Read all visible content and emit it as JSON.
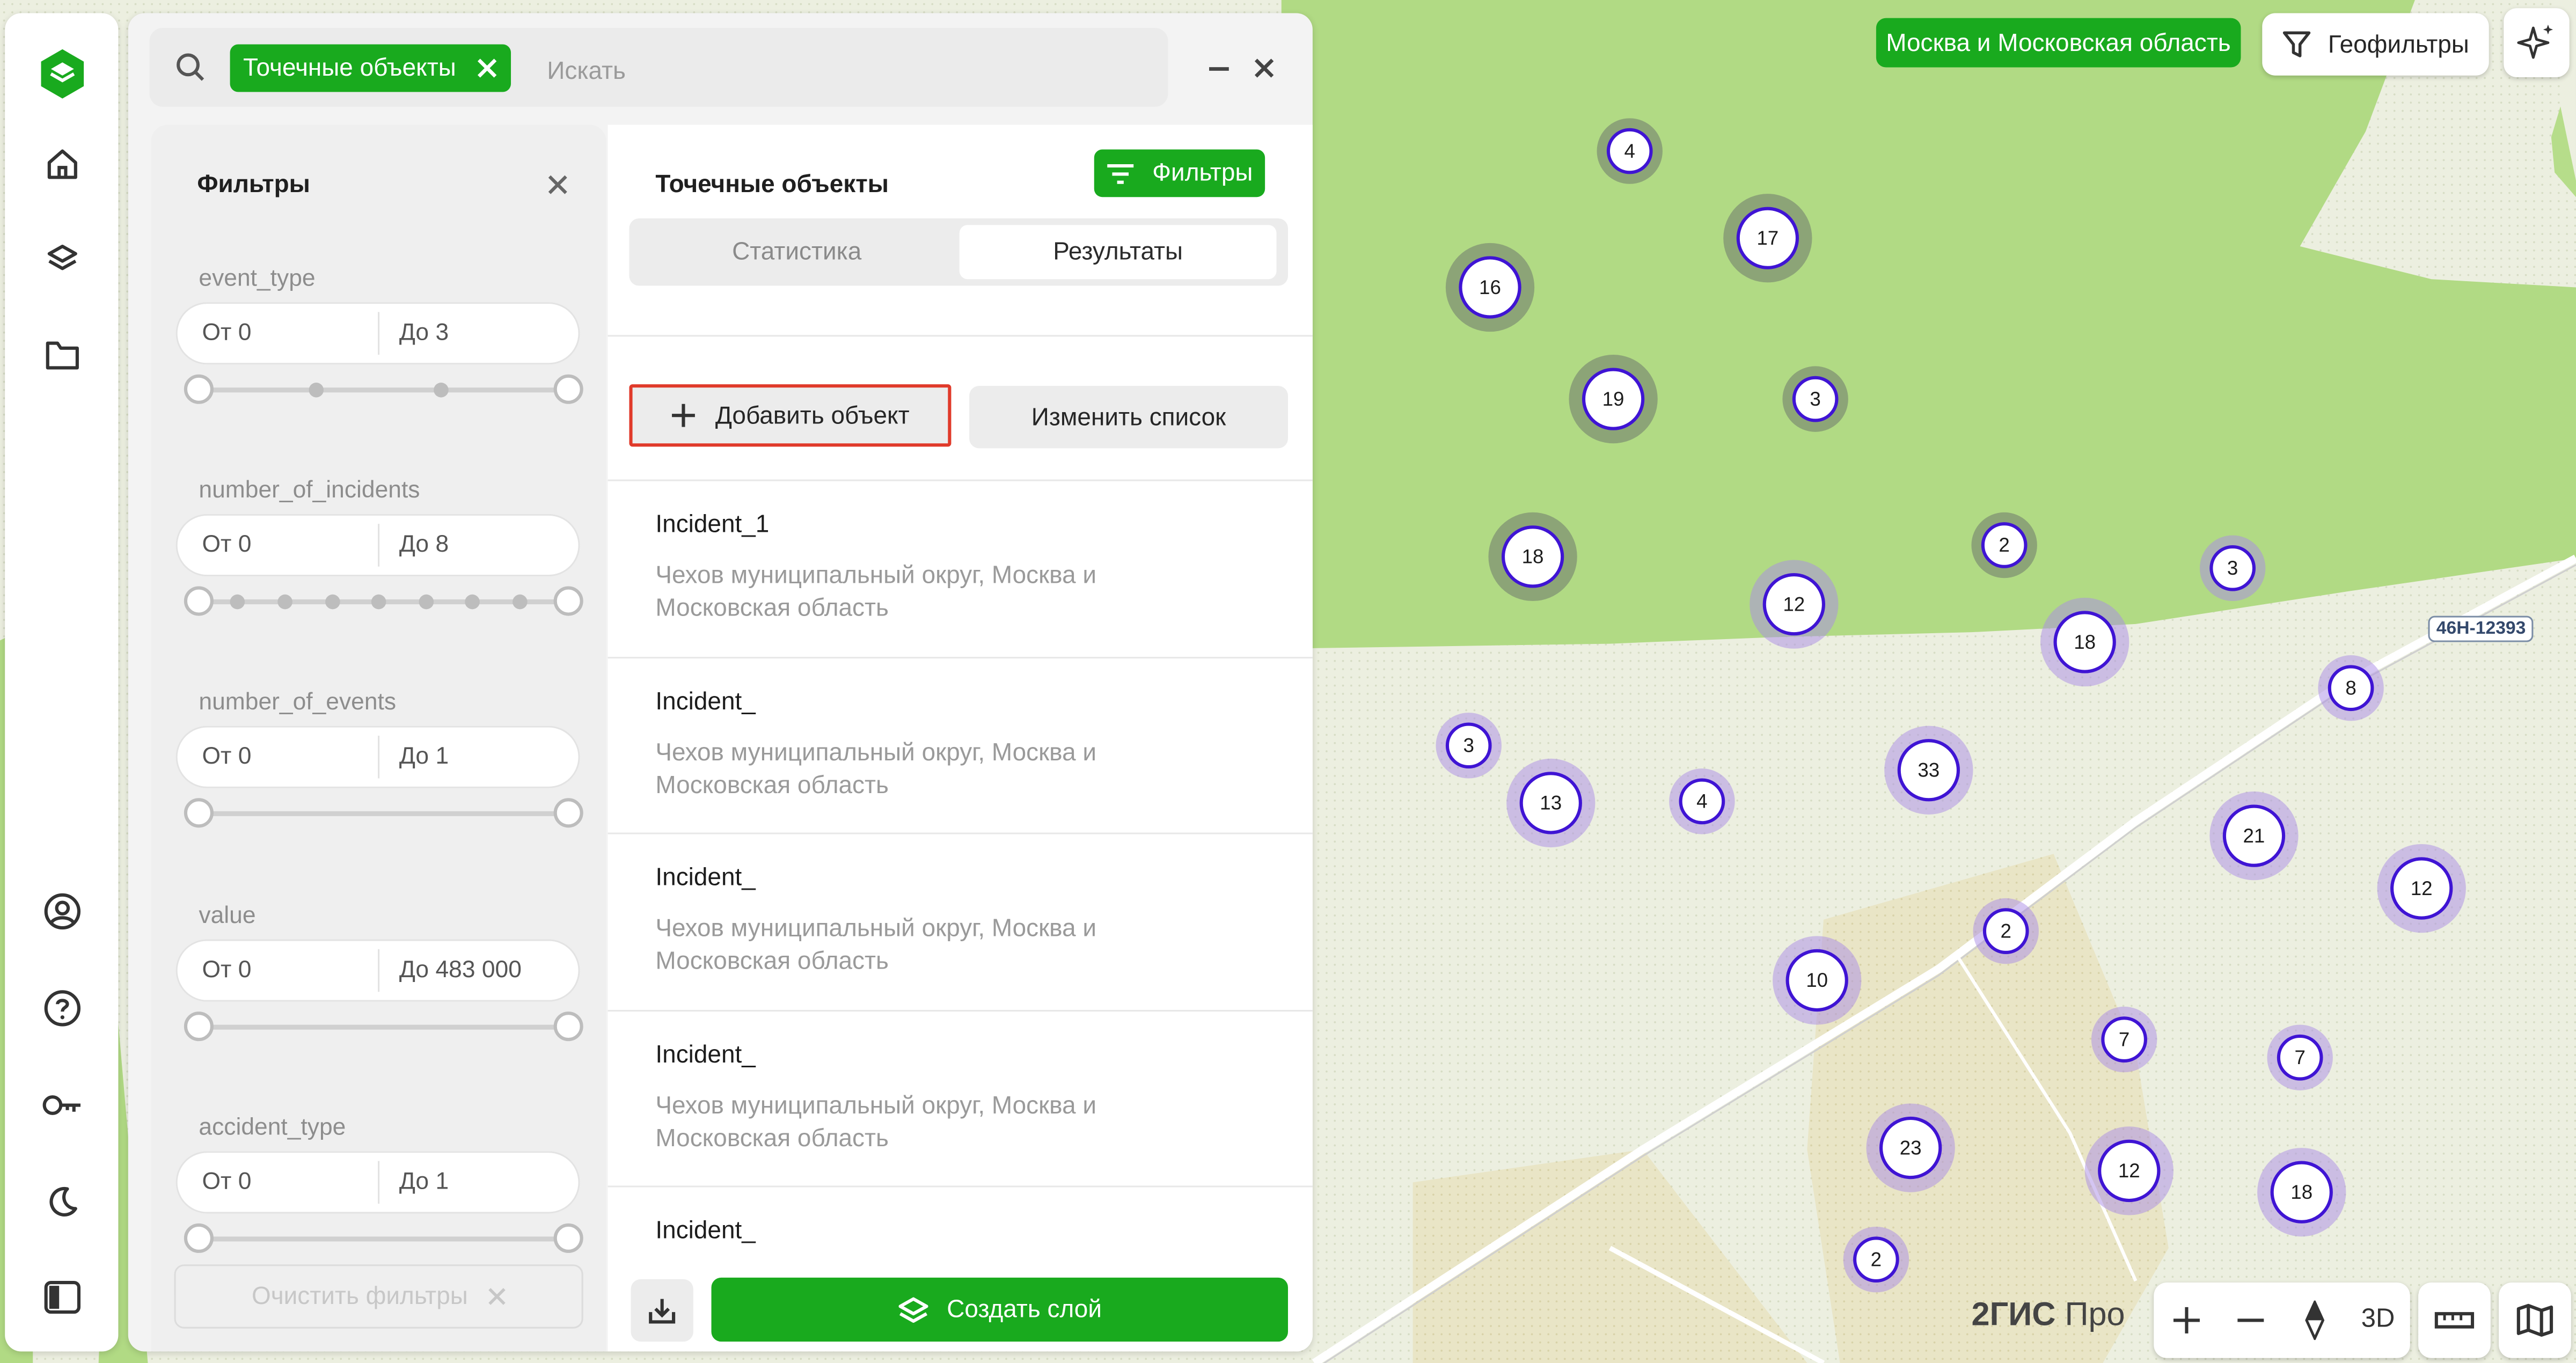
{
  "colors": {
    "accent": "#19aa1e",
    "cluster_ring": "#3f14d4",
    "highlight": "#e03a2a"
  },
  "search": {
    "chip_label": "Точечные объекты",
    "placeholder": "Искать",
    "value": ""
  },
  "filters": {
    "title": "Фильтры",
    "groups": [
      {
        "label": "event_type",
        "from": "От 0",
        "to": "До 3"
      },
      {
        "label": "number_of_incidents",
        "from": "От 0",
        "to": "До 8"
      },
      {
        "label": "number_of_events",
        "from": "От 0",
        "to": "До 1"
      },
      {
        "label": "value",
        "from": "От 0",
        "to": "До 483 000"
      },
      {
        "label": "accident_type",
        "from": "От 0",
        "to": "До 1"
      }
    ],
    "clear_label": "Очистить фильтры"
  },
  "results": {
    "title": "Точечные объекты",
    "filters_button": "Фильтры",
    "tabs": [
      "Статистика",
      "Результаты"
    ],
    "active_tab": "Результаты",
    "add_label": "Добавить объект",
    "edit_label": "Изменить список",
    "items": [
      {
        "name": "Incident_1",
        "address": "Чехов муниципальный округ, Москва и Московская область"
      },
      {
        "name": "Incident_",
        "address": "Чехов муниципальный округ, Москва и Московская область"
      },
      {
        "name": "Incident_",
        "address": "Чехов муниципальный округ, Москва и Московская область"
      },
      {
        "name": "Incident_",
        "address": "Чехов муниципальный округ, Москва и Московская область"
      },
      {
        "name": "Incident_",
        "address": ""
      }
    ],
    "create_label": "Создать слой"
  },
  "map": {
    "region": "Москва и Московская область",
    "geofilter_label": "Геофильтры",
    "road_label": "46Н-12393",
    "brand": "2ГИС",
    "brand_suffix": "Про",
    "mode_3d": "3D",
    "clusters": [
      "4",
      "17",
      "16",
      "19",
      "3",
      "18",
      "12",
      "2",
      "3",
      "18",
      "8",
      "3",
      "13",
      "4",
      "33",
      "21",
      "12",
      "2",
      "10",
      "7",
      "7",
      "23",
      "12",
      "18",
      "2"
    ]
  }
}
